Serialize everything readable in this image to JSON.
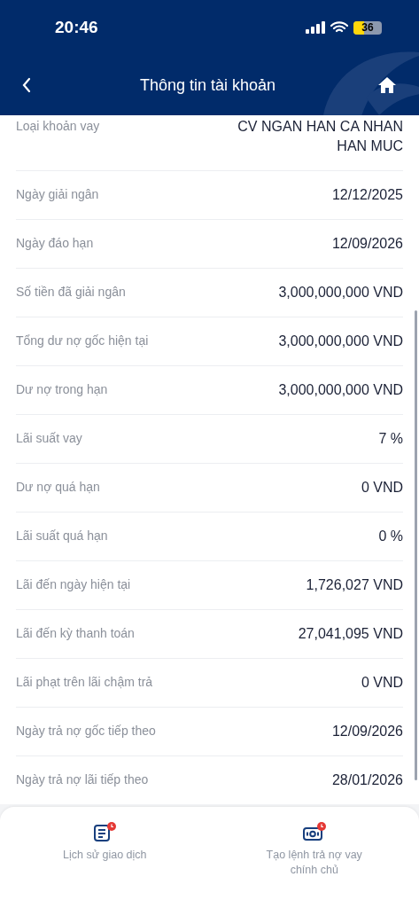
{
  "status_bar": {
    "time": "20:46",
    "battery": "36"
  },
  "header": {
    "title": "Thông tin tài khoản"
  },
  "rows": [
    {
      "label": "Loại khoản vay",
      "value": "CV NGAN HAN CA NHAN HAN MUC"
    },
    {
      "label": "Ngày giải ngân",
      "value": "12/12/2025"
    },
    {
      "label": "Ngày đáo hạn",
      "value": "12/09/2026"
    },
    {
      "label": "Số tiền đã giải ngân",
      "value": "3,000,000,000 VND"
    },
    {
      "label": "Tổng dư nợ gốc hiện tại",
      "value": "3,000,000,000 VND"
    },
    {
      "label": "Dư nợ trong hạn",
      "value": "3,000,000,000 VND"
    },
    {
      "label": "Lãi suất vay",
      "value": "7 %"
    },
    {
      "label": "Dư nợ quá hạn",
      "value": "0 VND"
    },
    {
      "label": "Lãi suất quá hạn",
      "value": "0 %"
    },
    {
      "label": "Lãi đến ngày hiện tại",
      "value": "1,726,027 VND"
    },
    {
      "label": "Lãi đến kỳ thanh toán",
      "value": "27,041,095 VND"
    },
    {
      "label": "Lãi phạt trên lãi chậm trả",
      "value": "0 VND"
    },
    {
      "label": "Ngày trả nợ gốc tiếp theo",
      "value": "12/09/2026"
    },
    {
      "label": "Ngày trả nợ lãi tiếp theo",
      "value": "28/01/2026"
    }
  ],
  "actions": [
    {
      "kind": "history",
      "label": "Lịch sử giao dịch"
    },
    {
      "kind": "payment",
      "label": "Tạo lệnh trả nợ vay chính chủ"
    }
  ]
}
